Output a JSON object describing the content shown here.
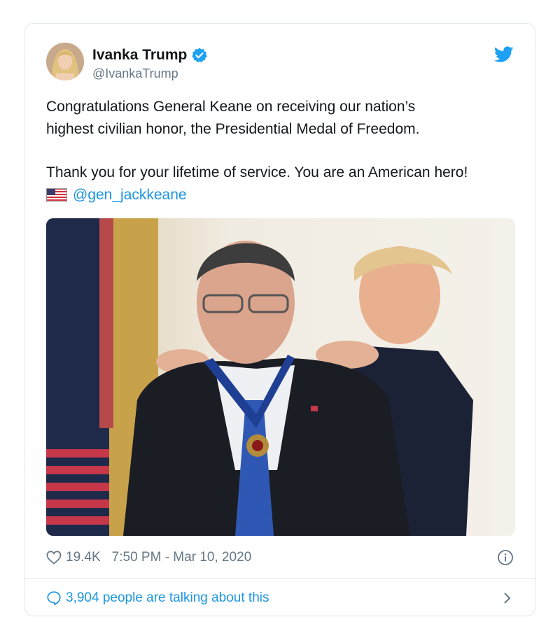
{
  "author": {
    "name": "Ivanka Trump",
    "handle": "@IvankaTrump"
  },
  "icons": {
    "avatar": "profile-photo",
    "verified": "verified-badge-icon",
    "brand": "twitter-bird-icon",
    "flag": "us-flag-emoji",
    "like": "heart-icon",
    "info": "info-icon",
    "reply": "speech-bubble-icon",
    "chevron": "chevron-right-icon"
  },
  "tweet": {
    "line1": "Congratulations General Keane on receiving our nation’s",
    "line2": "highest civilian honor, the Presidential Medal of Freedom.",
    "line3": "Thank you for your lifetime of service. You are an American hero!",
    "mention": "@gen_jackkeane"
  },
  "meta": {
    "likes": "19.4K",
    "timestamp": "7:50 PM - Mar 10, 2020"
  },
  "footer": {
    "talking": "3,904 people are talking about this"
  },
  "colors": {
    "accent": "#1b95e0",
    "muted": "#657786",
    "border": "#e1e8ed"
  }
}
